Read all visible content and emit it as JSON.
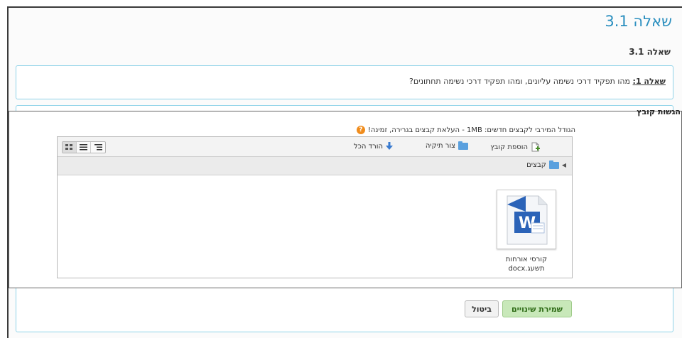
{
  "page": {
    "title": "שאלה 3.1",
    "section_heading": "שאלה 3.1"
  },
  "question": {
    "label": "שאלה 1:",
    "text": " מהו תפקיד דרכי נשימה עליונים, ומהו תפקיד דרכי נשימה תחתונים?"
  },
  "submission": {
    "label": "הגשות קובץ",
    "max_size_text": "הגודל המירבי לקבצים חדשים: 1MB - העלאת קבצים בגרירה, זמינה!",
    "help_icon": "?"
  },
  "file_manager": {
    "toolbar": {
      "add_file": "הוספת קובץ",
      "create_folder": "צור תיקיה",
      "download_all": "הורד הכל"
    },
    "path": {
      "folder": "קבצים"
    },
    "files": [
      {
        "name_line1": "קורסי אורחות",
        "name_line2": "תשעג.docx",
        "icon": "word-document-icon"
      }
    ]
  },
  "buttons": {
    "save": "שמירת שינויים",
    "cancel": "ביטול"
  },
  "colors": {
    "title": "#2b8fbf",
    "box_border": "#8fd3e8",
    "save_bg": "#c8e8b9",
    "word_blue": "#2b63b8"
  }
}
